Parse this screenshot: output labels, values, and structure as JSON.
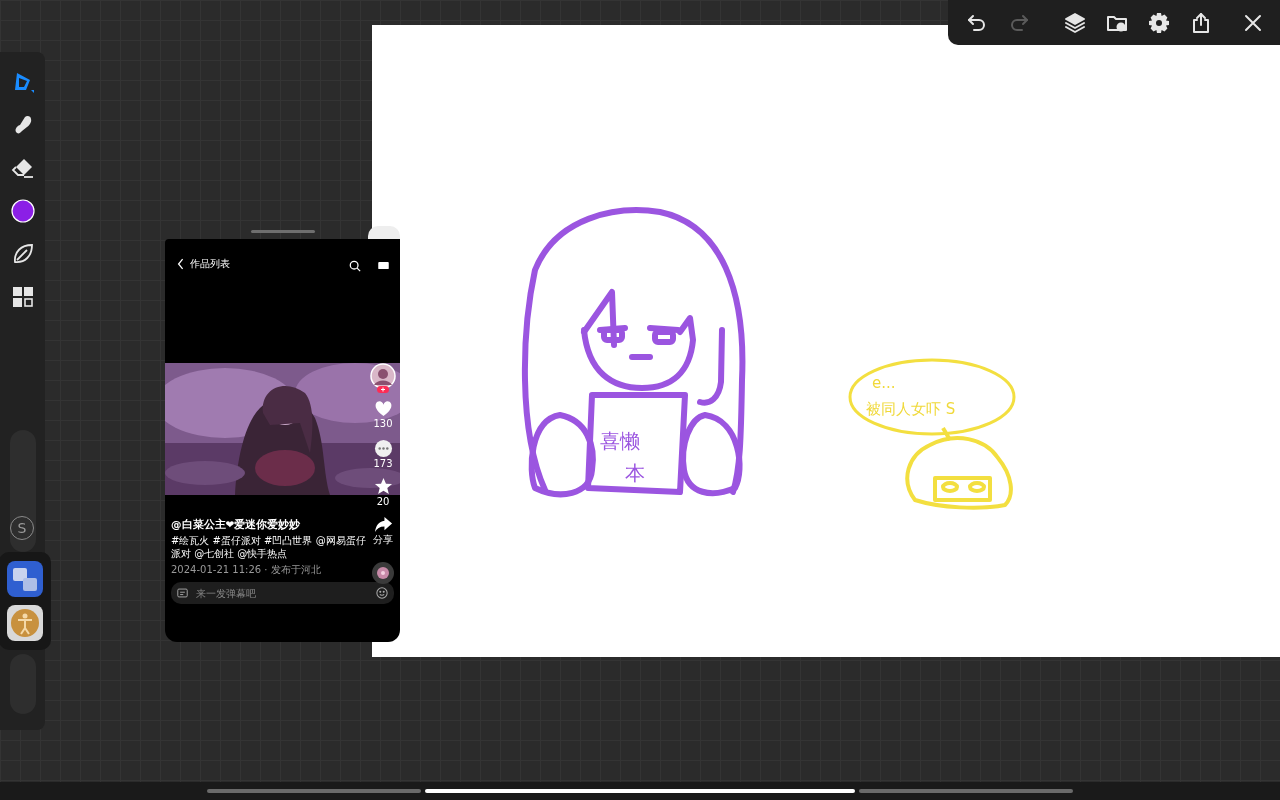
{
  "top_toolbar": {
    "buttons": [
      {
        "kind": "undo",
        "disabled": false
      },
      {
        "kind": "redo",
        "disabled": true
      },
      {
        "kind": "layers",
        "disabled": false
      },
      {
        "kind": "import",
        "disabled": false
      },
      {
        "kind": "settings",
        "disabled": false
      },
      {
        "kind": "share",
        "disabled": false
      },
      {
        "kind": "close",
        "disabled": false
      }
    ]
  },
  "tools": [
    {
      "kind": "pen",
      "selected": true
    },
    {
      "kind": "smudge",
      "selected": false
    },
    {
      "kind": "eraser",
      "selected": false
    },
    {
      "kind": "color",
      "selected": false,
      "color": "#8b1fe6"
    },
    {
      "kind": "leaf",
      "selected": false
    },
    {
      "kind": "gallery",
      "selected": false
    }
  ],
  "sliders": [
    {
      "level": 0
    },
    {
      "level": 0
    }
  ],
  "side_button": "S",
  "quick_apps": [
    {
      "kind": "cards"
    },
    {
      "kind": "figure"
    }
  ],
  "canvas": {
    "sign_text": [
      "喜懒",
      "本"
    ],
    "bubble_text": [
      "e...",
      "被同人女吓 S"
    ]
  },
  "floating_window": {
    "title": "作品列表",
    "actions": [
      {
        "kind": "avatar"
      },
      {
        "kind": "like",
        "count": "130"
      },
      {
        "kind": "comment",
        "count": "173"
      },
      {
        "kind": "favorite",
        "count": "20"
      },
      {
        "kind": "share",
        "count": "分享"
      }
    ],
    "author": "@白菜公主❤爱迷你爱妙妙",
    "tags": "#绘瓦火 #蛋仔派对 #凹凸世界 @网易蛋仔派对 @七创社 @快手热点",
    "date": "2024-01-21 11:26 · 发布于河北",
    "comment_placeholder": "来一发弹幕吧"
  }
}
